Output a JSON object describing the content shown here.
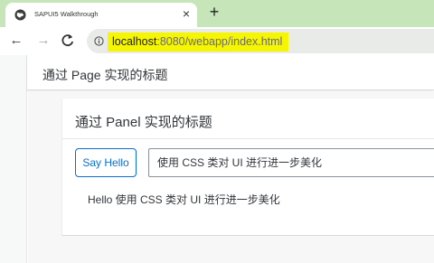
{
  "browser": {
    "tab_title": "SAPUI5 Walkthrough",
    "tab_close": "×",
    "new_tab": "+",
    "back": "←",
    "forward": "→",
    "reload": "C",
    "url_host": "localhost",
    "url_rest": ":8080/webapp/index.html"
  },
  "colors": {
    "tabstrip": "#c6e6b9",
    "url_highlight": "#f6f600",
    "accent": "#0a6ed1"
  },
  "page": {
    "title": "通过 Page 实现的标题",
    "panel": {
      "title": "通过 Panel 实现的标题",
      "say_hello_label": "Say Hello",
      "input_value": "使用 CSS 类对 UI 进行进一步美化",
      "hello_text": "Hello 使用 CSS 类对 UI 进行进一步美化"
    }
  }
}
